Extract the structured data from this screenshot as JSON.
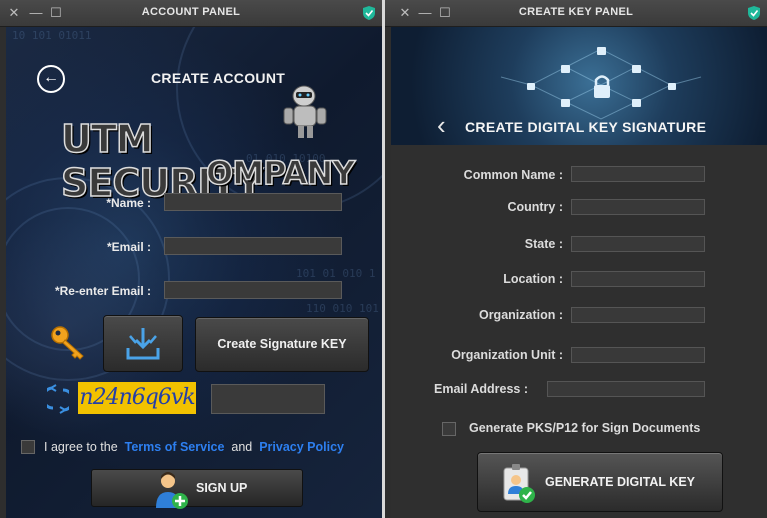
{
  "left_window": {
    "title": "ACCOUNT PANEL",
    "close": "✕",
    "minimize": "—",
    "maximize": "☐",
    "heading": "CREATE ACCOUNT",
    "logo_line1": "UTM SECURITY",
    "logo_line2": "OMPANY",
    "fields": {
      "name_label": "*Name :",
      "email_label": "*Email :",
      "reenter_email_label": "*Re-enter Email :"
    },
    "create_signature_key_label": "Create Signature KEY",
    "captcha_text": "n24n6q6vk",
    "agree_text": "I agree to the",
    "terms_link": "Terms of Service",
    "and_text": "and",
    "privacy_link": "Privacy Policy",
    "signup_label": "SIGN UP",
    "background_binary": [
      "10 101 01011",
      "01 010 10100",
      "101 01 010 1",
      "110 010 101"
    ],
    "colors": {
      "link": "#2d7ff0",
      "captcha_bg": "#f2c200",
      "captcha_fg": "#233fa8"
    }
  },
  "right_window": {
    "title": "CREATE KEY PANEL",
    "close": "✕",
    "minimize": "—",
    "maximize": "☐",
    "heading": "CREATE DIGITAL KEY SIGNATURE",
    "back": "‹",
    "fields": {
      "common_name": "Common Name :",
      "country": "Country :",
      "state": "State :",
      "location": "Location :",
      "organization": "Organization :",
      "organization_unit": "Organization Unit :",
      "email_address": "Email Address :"
    },
    "pks_option": "Generate PKS/P12 for Sign Documents",
    "generate_label": "GENERATE DIGITAL KEY"
  }
}
